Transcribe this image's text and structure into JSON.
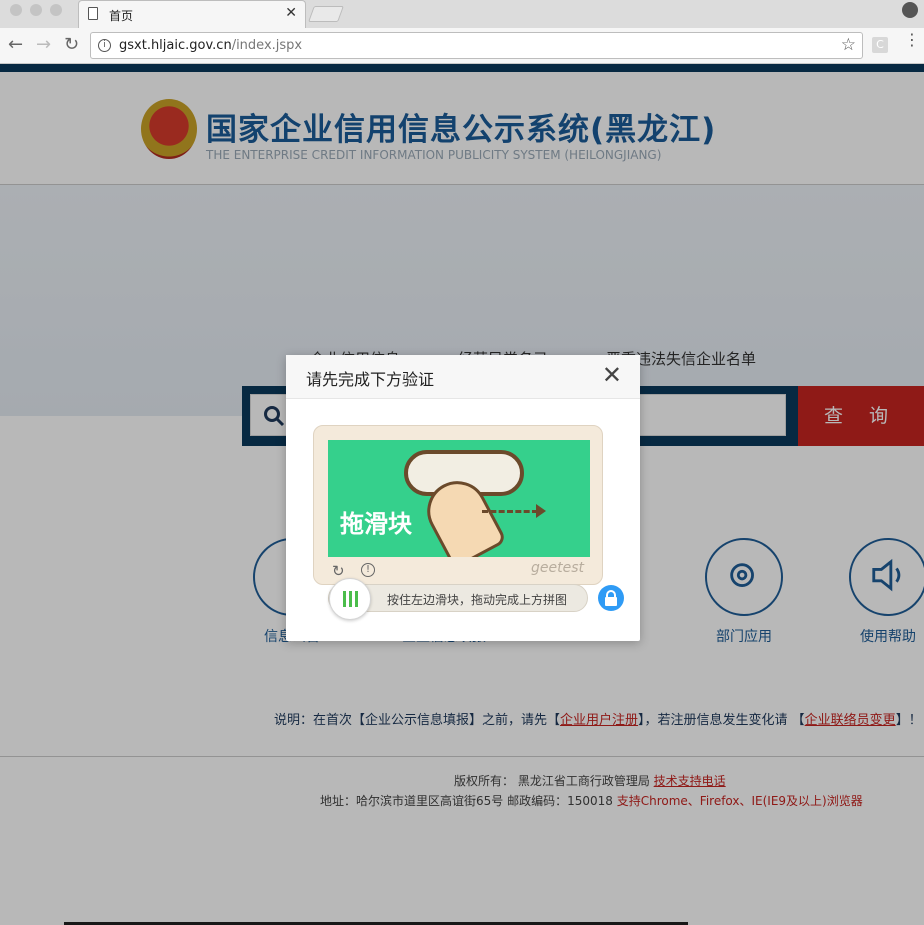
{
  "browser": {
    "tab_title": "首页",
    "url_host": "gsxt.hljaic.gov.cn",
    "url_path": "/index.jspx",
    "ext_label": "C"
  },
  "header": {
    "title": "国家企业信用信息公示系统(黑龙江)",
    "subtitle": "THE ENTERPRISE CREDIT INFORMATION PUBLICITY SYSTEM (HEILONGJIANG)"
  },
  "search": {
    "tabs": [
      "企业信用信息",
      "经营异常名录",
      "严重违法失信企业名单"
    ],
    "button_label": "查 询"
  },
  "functions": [
    {
      "label": "信息公告",
      "icon": "document-icon"
    },
    {
      "label": "企业信息填报",
      "icon": "form-icon"
    },
    {
      "label": "部门应用",
      "icon": "gear-icon"
    },
    {
      "label": "使用帮助",
      "icon": "speaker-icon"
    }
  ],
  "note": {
    "prefix": "说明：在首次【企业公示信息填报】之前，请先【",
    "link1": "企业用户注册",
    "middle": "】，若注册信息发生变化请 【",
    "link2": "企业联络员变更",
    "suffix": "】！"
  },
  "footer": {
    "copyright_prefix": "版权所有：  黑龙江省工商行政管理局  ",
    "support_link": "技术支持电话",
    "address": "地址：哈尔滨市道里区高谊街65号   邮政编码：150018   ",
    "browser_note": "支持Chrome、Firefox、IE(IE9及以上)浏览器"
  },
  "modal": {
    "title": "请先完成下方验证",
    "captcha_text": "拖滑块",
    "brand": "geetest",
    "slider_tip": "按住左边滑块，拖动完成上方拼图"
  }
}
